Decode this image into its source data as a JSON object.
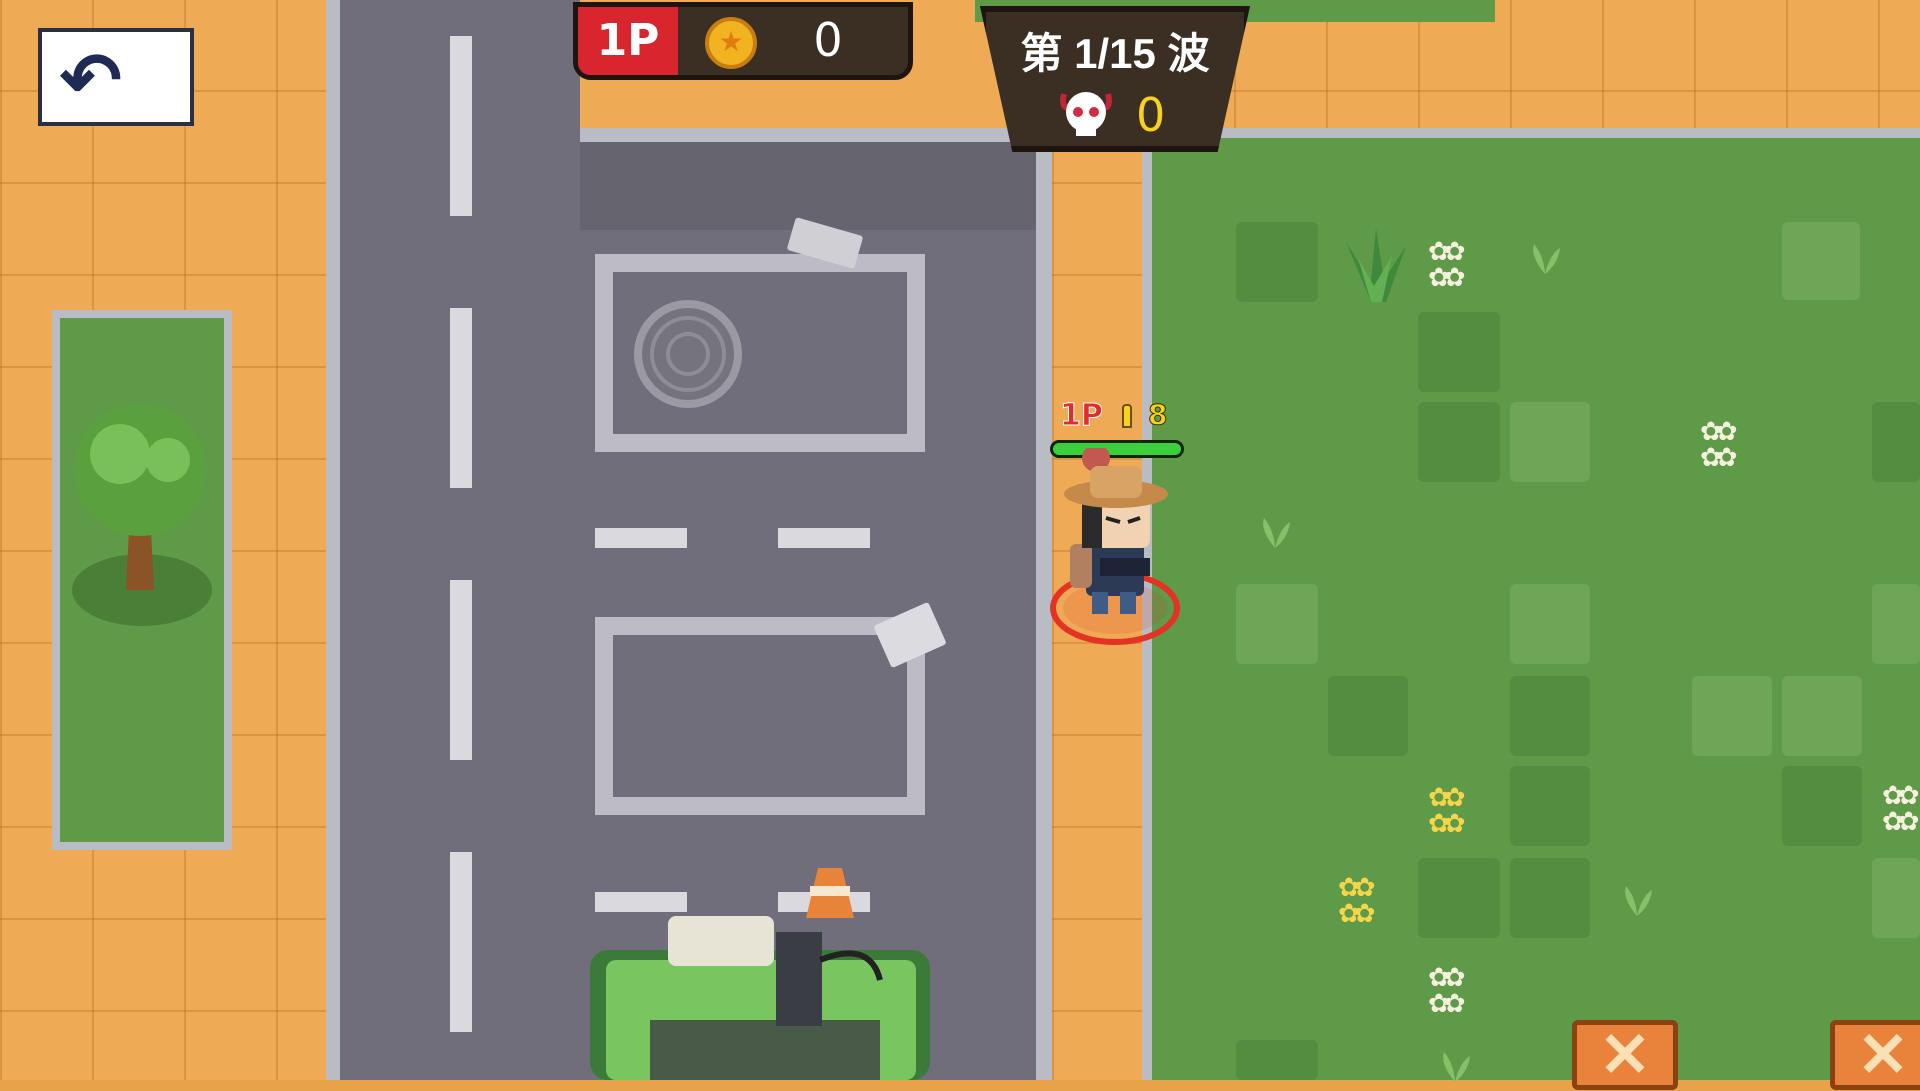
{
  "hud": {
    "player_badge": "1P",
    "coins": "0",
    "wave_label": "第 1/15 波",
    "kills": "0"
  },
  "player": {
    "tag": "1P",
    "ammo": "8",
    "health_fraction": 1.0
  },
  "icons": {
    "back": "back-arrow-icon",
    "coin": "coin-icon",
    "skull": "skull-icon",
    "ammo": "bullet-icon"
  },
  "colors": {
    "badge_red": "#d9262e",
    "hud_bg": "#3b2e22",
    "kill_yellow": "#f5d31a",
    "hp_green": "#3ccf3c",
    "grass": "#5f9a49",
    "road": "#6f6e7a",
    "sidewalk": "#eeaa55"
  }
}
